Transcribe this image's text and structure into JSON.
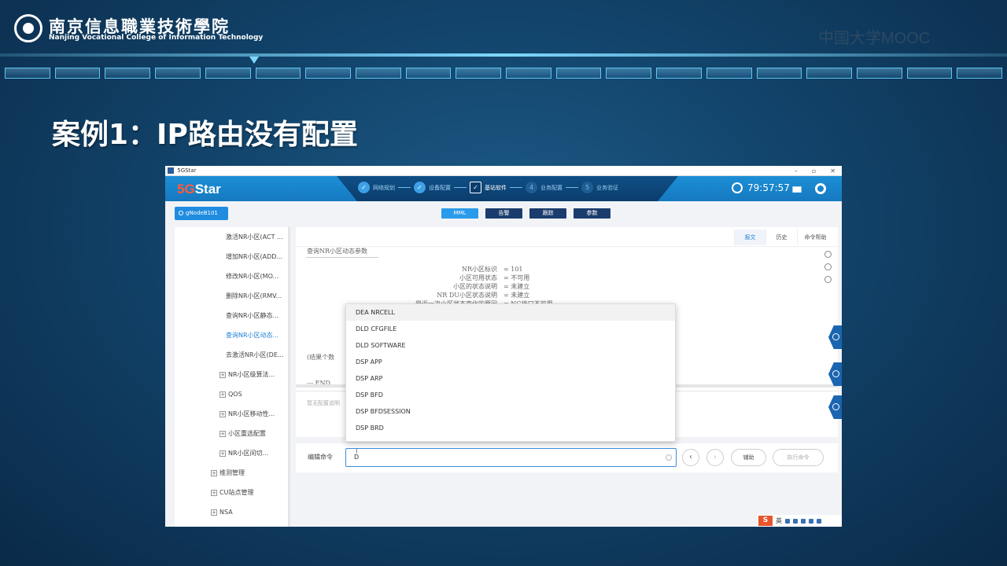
{
  "slide": {
    "school_cn": "南京信息職業技術學院",
    "school_en": "Nanjing Vocational College of Information Technology",
    "mooc": "中国大学MOOC",
    "title": "案例1：IP路由没有配置"
  },
  "window": {
    "title": "5GStar",
    "controls": [
      "–",
      "▫",
      "✕"
    ]
  },
  "header": {
    "brand_5g": "5G",
    "brand_star": "Star",
    "steps": [
      {
        "icon": "✓",
        "label": "网络规划"
      },
      {
        "icon": "✓",
        "label": "设备配置"
      },
      {
        "icon": "✓",
        "label": "基站软件"
      },
      {
        "icon": "4",
        "label": "业务配置"
      },
      {
        "icon": "5",
        "label": "业务验证"
      }
    ],
    "time": "79:57:57"
  },
  "subnav": {
    "node": "gNodeB101",
    "tabs": [
      "MML",
      "告警",
      "跟踪",
      "参数"
    ]
  },
  "sidebar": {
    "items": [
      {
        "label": "激活NR小区(ACT ..."
      },
      {
        "label": "增加NR小区(ADD..."
      },
      {
        "label": "修改NR小区(MO..."
      },
      {
        "label": "删除NR小区(RMV..."
      },
      {
        "label": "查询NR小区静态..."
      },
      {
        "label": "查询NR小区动态..."
      },
      {
        "label": "去激活NR小区(DE..."
      },
      {
        "label": "NR小区级算法..."
      },
      {
        "label": "QOS"
      },
      {
        "label": "NR小区移动性..."
      },
      {
        "label": "小区重选配置"
      },
      {
        "label": "NR小区间切..."
      },
      {
        "label": "维测管理"
      },
      {
        "label": "CU站点管理"
      },
      {
        "label": "NSA"
      }
    ]
  },
  "content": {
    "tabs": [
      "报文",
      "历史",
      "命令帮助"
    ],
    "result_title": "查询NR小区动态参数",
    "rows": [
      {
        "key": "NR小区标识",
        "value": "=  101"
      },
      {
        "key": "小区可用状态",
        "value": "=  不可用"
      },
      {
        "key": "小区的状态说明",
        "value": "=  未建立"
      },
      {
        "key": "NR DU小区状态说明",
        "value": "=  未建立"
      },
      {
        "key": "最近一次小区状态变化的原因",
        "value": "=  NG接口不可用"
      }
    ],
    "count_text": "(结果个数",
    "end_text": "---    END",
    "config_placeholder": "暂无配置说明"
  },
  "command": {
    "label": "编辑命令",
    "value": "D",
    "assist": "辅助",
    "execute": "执行命令"
  },
  "dropdown": {
    "options": [
      "DEA NRCELL",
      "DLD CFGFILE",
      "DLD SOFTWARE",
      "DSP APP",
      "DSP ARP",
      "DSP BFD",
      "DSP BFDSESSION",
      "DSP BRD"
    ]
  },
  "taskbar": {
    "ime": "S",
    "lang": "英"
  }
}
